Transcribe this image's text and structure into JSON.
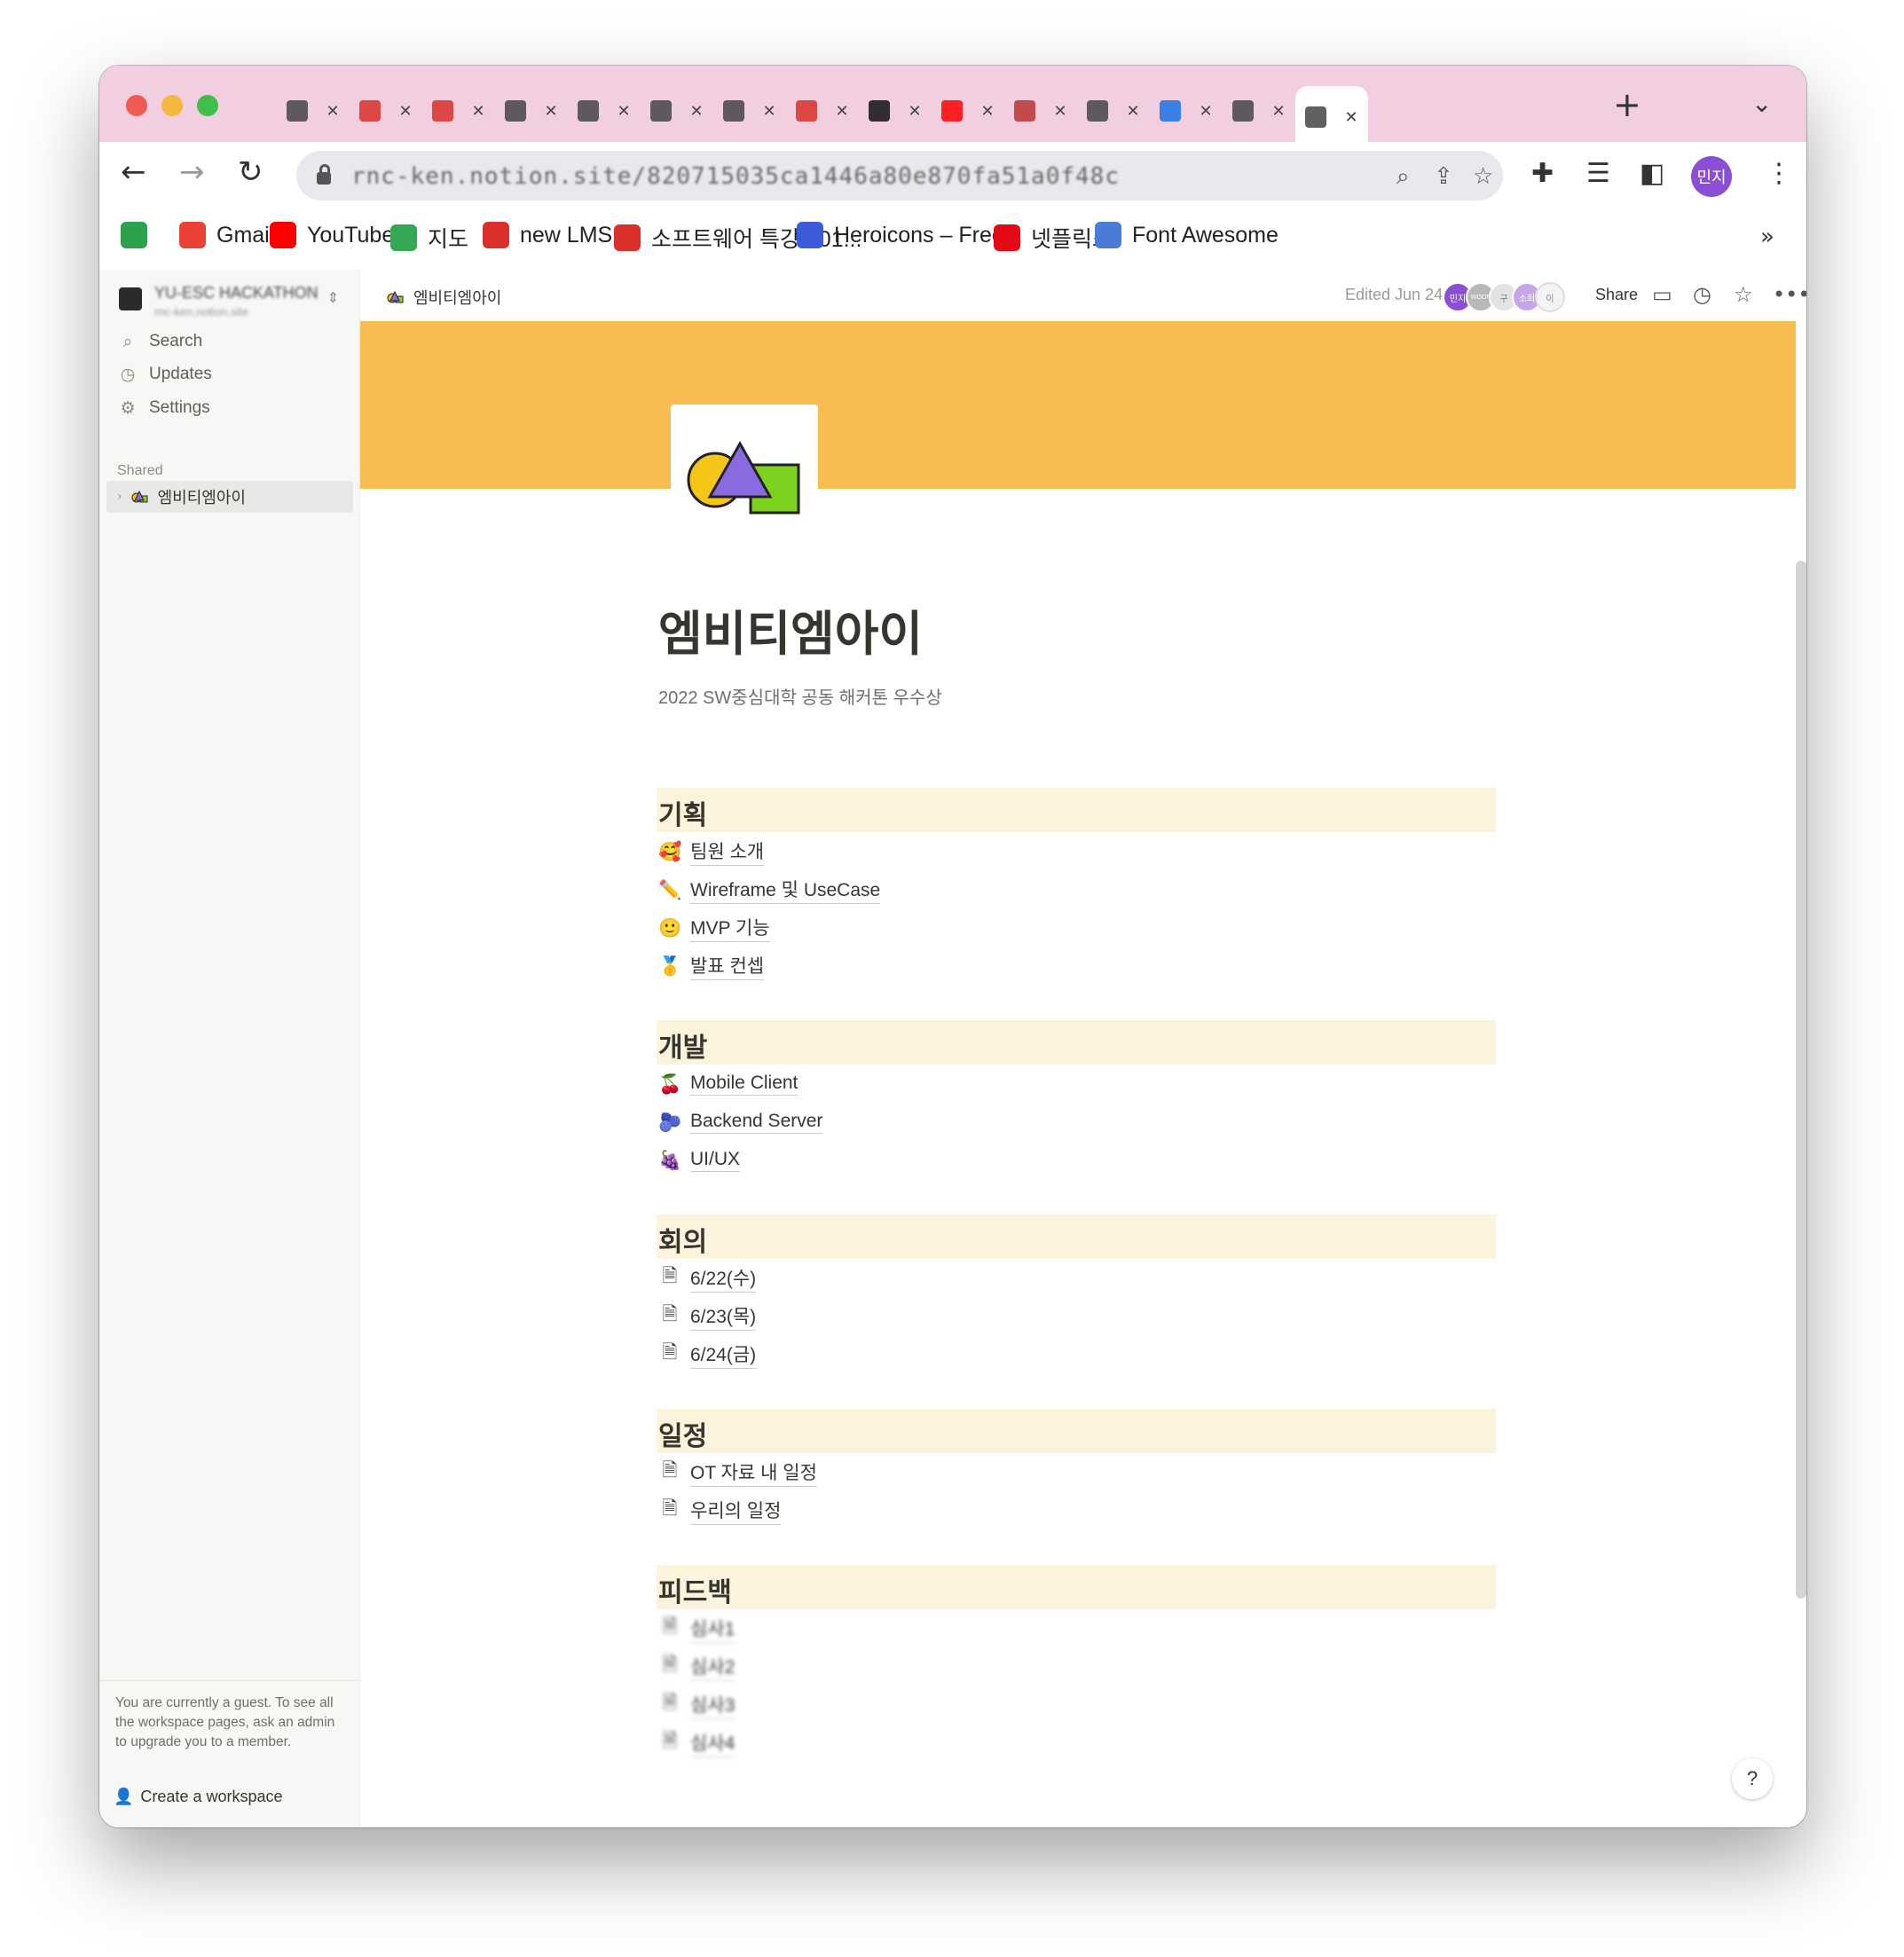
{
  "browser": {
    "tabs": [
      {
        "label": "",
        "color": "#444444"
      },
      {
        "label": "",
        "color": "#d9302c"
      },
      {
        "label": "",
        "color": "#d9302c"
      },
      {
        "label": "",
        "color": "#444444"
      },
      {
        "label": "",
        "color": "#444444"
      },
      {
        "label": "",
        "color": "#444444"
      },
      {
        "label": "",
        "color": "#444444"
      },
      {
        "label": "",
        "color": "#d9302c"
      },
      {
        "label": "",
        "color": "#111111"
      },
      {
        "label": "",
        "color": "#ff0000"
      },
      {
        "label": "",
        "color": "#b33"
      },
      {
        "label": "",
        "color": "#444444"
      },
      {
        "label": "",
        "color": "#1a73e8"
      },
      {
        "label": "",
        "color": "#444444"
      },
      {
        "label": "",
        "color": "#444444"
      }
    ],
    "tab_close": "✕",
    "url": "rnc-ken.notion.site/820715035ca1446a80e870fa51a0f48c",
    "profile_initials": "민지"
  },
  "bookmarks": [
    {
      "label": "",
      "icon": "gmail-pile-icon",
      "color": "#2ca24c"
    },
    {
      "label": "Gmail",
      "icon": "gmail-icon",
      "color": "#ea4335"
    },
    {
      "label": "YouTube",
      "icon": "youtube-icon",
      "color": "#ff0000"
    },
    {
      "label": "지도",
      "icon": "maps-icon",
      "color": "#34a853"
    },
    {
      "label": "new LMS",
      "icon": "lms-icon",
      "color": "#d9302c"
    },
    {
      "label": "소프트웨어 특강 001...",
      "icon": "lms-icon",
      "color": "#d9302c"
    },
    {
      "label": "Heroicons – Free...",
      "icon": "flag-icon",
      "color": "#3b5bdb"
    },
    {
      "label": "넷플릭스",
      "icon": "netflix-icon",
      "color": "#e50914"
    },
    {
      "label": "Font Awesome",
      "icon": "flag-outline-icon",
      "color": "#4a7bd6"
    }
  ],
  "sidebar": {
    "workspace_name": "YU-ESC HACKATHON",
    "workspace_sub": "rnc-ken.notion.site",
    "items": [
      {
        "label": "Search",
        "icon": "search-icon"
      },
      {
        "label": "Updates",
        "icon": "clock-icon"
      },
      {
        "label": "Settings",
        "icon": "gear-icon"
      }
    ],
    "section": "Shared",
    "shared_page": "엠비티엠아이",
    "guest_notice": "You are currently a guest. To see all the workspace pages, ask an admin to upgrade you to a member.",
    "create_workspace": "Create a workspace"
  },
  "topbar": {
    "breadcrumb": "엠비티엠아이",
    "edited": "Edited Jun 24",
    "avatars": [
      "민지",
      "WOON",
      "구",
      "소희",
      "이"
    ],
    "share": "Share"
  },
  "page": {
    "title": "엠비티엠아이",
    "subtitle": "2022 SW중심대학 공동 해커톤 우수상",
    "cover_color": "#f7bd52",
    "sections": [
      {
        "heading": "기획",
        "links": [
          {
            "emoji": "🥰",
            "label": "팀원 소개"
          },
          {
            "emoji": "✏️",
            "label": "Wireframe 및 UseCase"
          },
          {
            "emoji": "🙂",
            "label": "MVP 기능"
          },
          {
            "emoji": "🥇",
            "label": "발표 컨셉"
          }
        ]
      },
      {
        "heading": "개발",
        "links": [
          {
            "emoji": "🍒",
            "label": "Mobile Client"
          },
          {
            "emoji": "🫐",
            "label": "Backend Server"
          },
          {
            "emoji": "🍇",
            "label": "UI/UX"
          }
        ]
      },
      {
        "heading": "회의",
        "links": [
          {
            "emoji": "🗎",
            "label": "6/22(수)"
          },
          {
            "emoji": "🗎",
            "label": "6/23(목)"
          },
          {
            "emoji": "🗎",
            "label": "6/24(금)"
          }
        ]
      },
      {
        "heading": "일정",
        "links": [
          {
            "emoji": "🗎",
            "label": "OT 자료 내 일정"
          },
          {
            "emoji": "🗎",
            "label": "우리의 일정"
          }
        ]
      },
      {
        "heading": "피드백",
        "links": [
          {
            "emoji": "🗎",
            "label": "심사1"
          },
          {
            "emoji": "🗎",
            "label": "심사2"
          },
          {
            "emoji": "🗎",
            "label": "심사3"
          },
          {
            "emoji": "🗎",
            "label": "심사4"
          }
        ]
      }
    ]
  },
  "help": "?"
}
